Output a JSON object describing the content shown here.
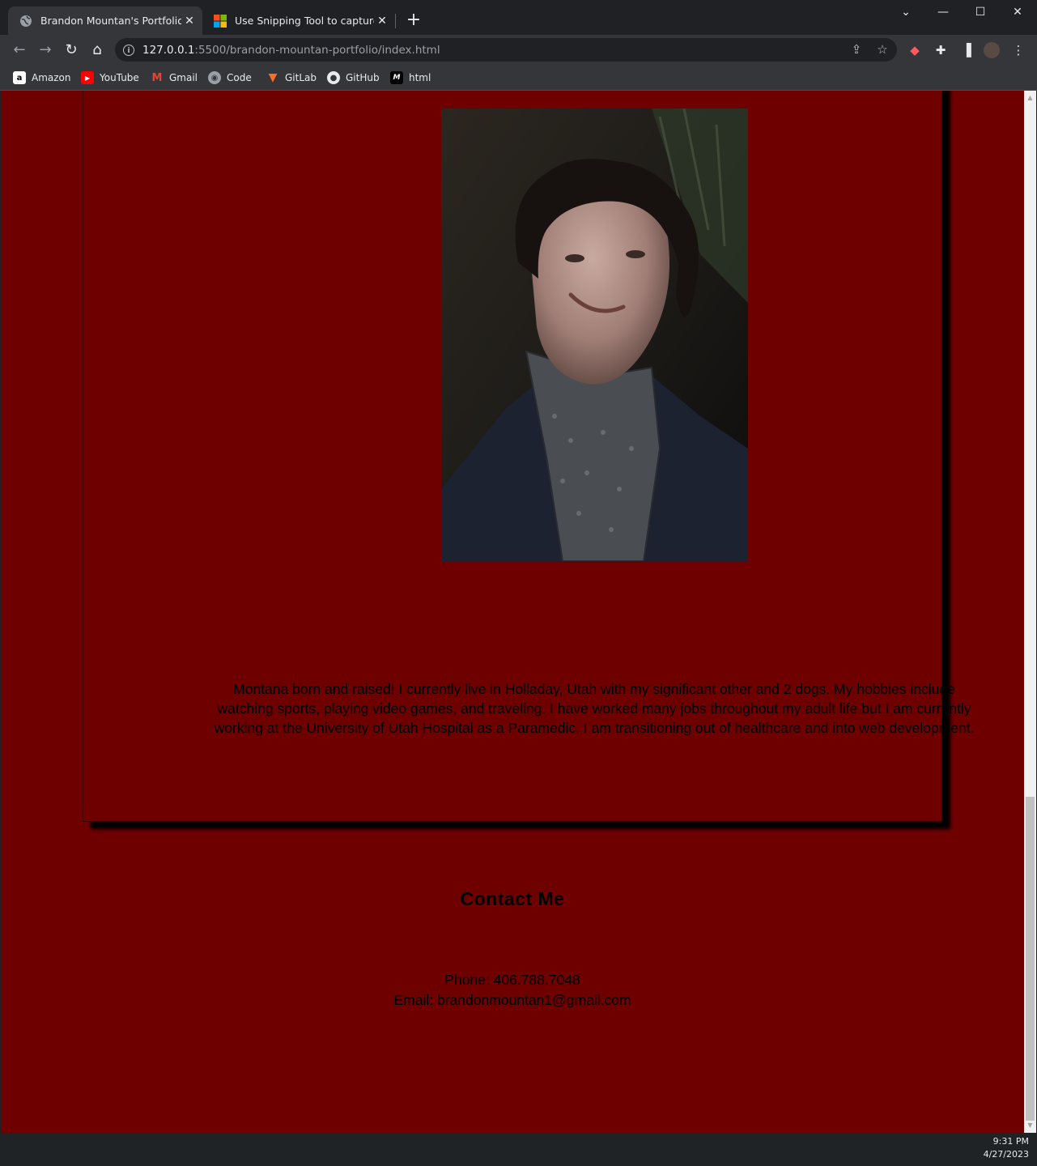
{
  "browser": {
    "tabs": [
      {
        "title": "Brandon Mountan's Portfolio",
        "active": true
      },
      {
        "title": "Use Snipping Tool to capture scre",
        "active": false
      }
    ],
    "new_tab_label": "+",
    "url_host": "127.0.0.1",
    "url_rest": ":5500/brandon-mountan-portfolio/index.html",
    "bookmarks": [
      "Amazon",
      "YouTube",
      "Gmail",
      "Code",
      "GitLab",
      "GitHub",
      "html"
    ]
  },
  "page": {
    "bio": "Montana born and raised! I currently live in Holladay, Utah with my significant other and 2 dogs. My hobbies include watching sports, playing video games, and traveling. I have worked many jobs throughout my adult life but I am currently working at the University of Utah Hospital as a Paramedic. I am transitioning out of healthcare and into web development.",
    "contact_title": "Contact Me",
    "phone": "Phone: 406.788.7048",
    "email": "Email: brandonmountan1@gmail.com"
  },
  "taskbar": {
    "time": "9:31 PM",
    "date": "4/27/2023"
  },
  "colors": {
    "page_background": "#6e0000",
    "text": "#000000"
  }
}
